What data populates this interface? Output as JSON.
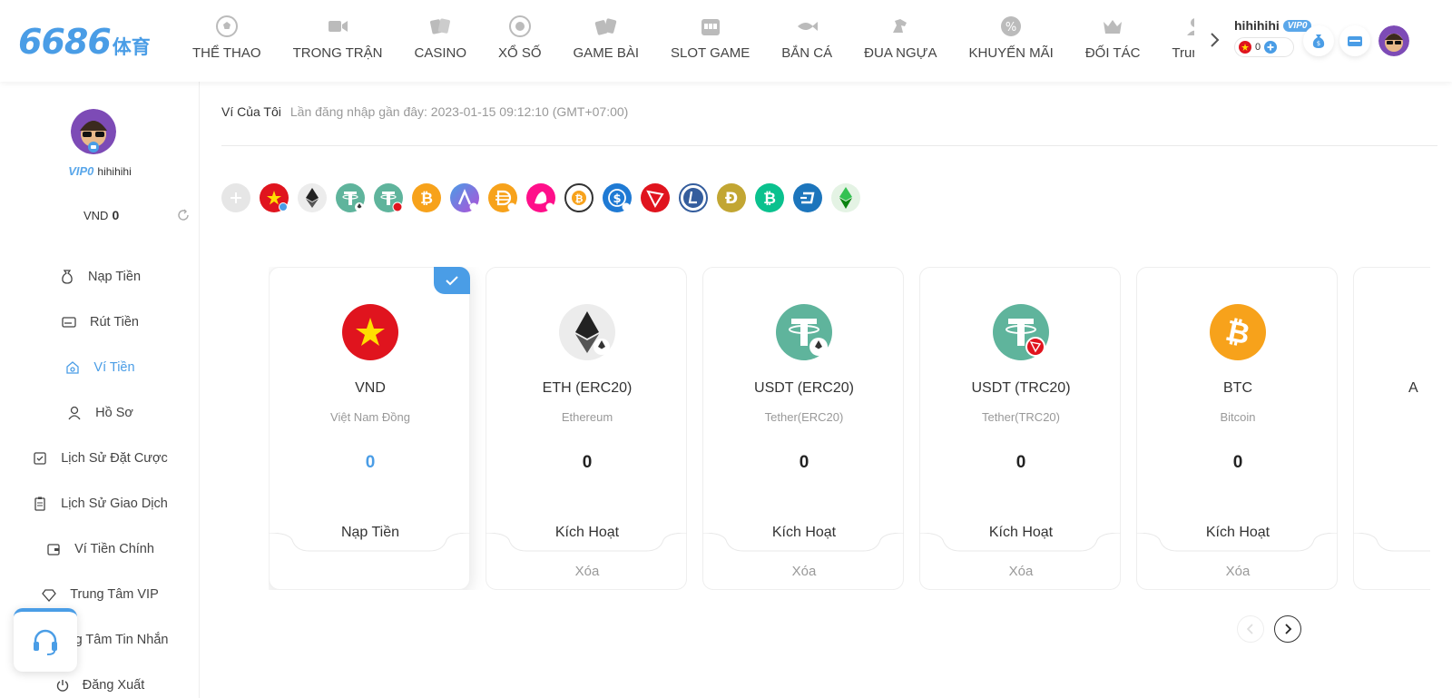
{
  "header": {
    "logo_num": "6686",
    "logo_sub": "体育",
    "nav": [
      {
        "label": "THỂ THAO",
        "icon": "soccer-ball-icon"
      },
      {
        "label": "TRONG TRẬN",
        "icon": "video-camera-icon"
      },
      {
        "label": "CASINO",
        "icon": "playing-cards-icon"
      },
      {
        "label": "XỔ SỐ",
        "icon": "lottery-ball-icon"
      },
      {
        "label": "GAME BÀI",
        "icon": "card-game-icon"
      },
      {
        "label": "SLOT GAME",
        "icon": "slot-machine-icon"
      },
      {
        "label": "BẮN CÁ",
        "icon": "fish-icon"
      },
      {
        "label": "ĐUA NGỰA",
        "icon": "horse-icon"
      },
      {
        "label": "KHUYẾN MÃI",
        "icon": "percent-badge-icon"
      },
      {
        "label": "ĐỐI TÁC",
        "icon": "crown-icon"
      },
      {
        "label": "Trung T",
        "icon": "person-icon"
      }
    ],
    "user": {
      "name": "hihihihi",
      "vip": "VIP0",
      "balance": "0"
    }
  },
  "sidebar": {
    "vip": "VIP0",
    "username": "hihihihi",
    "currency": "VND",
    "balance": "0",
    "menu": [
      {
        "label": "Nạp Tiền",
        "icon": "money-bag-icon"
      },
      {
        "label": "Rút Tiền",
        "icon": "card-icon"
      },
      {
        "label": "Ví Tiền",
        "icon": "wallet-icon"
      },
      {
        "label": "Hồ Sơ",
        "icon": "user-icon"
      },
      {
        "label": "Lịch Sử Đặt Cược",
        "icon": "checklist-icon"
      },
      {
        "label": "Lịch Sử Giao Dịch",
        "icon": "clipboard-icon"
      },
      {
        "label": "Ví Tiền Chính",
        "icon": "purse-icon"
      },
      {
        "label": "Trung Tâm VIP",
        "icon": "diamond-icon"
      },
      {
        "label": "ng Tâm Tin Nhắn",
        "icon": "message-icon"
      },
      {
        "label": "Đăng Xuất",
        "icon": "power-icon"
      }
    ]
  },
  "main": {
    "title": "Ví Của Tôi",
    "last_login": "Lần đăng nhập gần đây: 2023-01-15 09:12:10 (GMT+07:00)",
    "cards": [
      {
        "name": "VND",
        "sub": "Việt Nam Đồng",
        "balance": "0",
        "action": "Nạp Tiền",
        "del": ""
      },
      {
        "name": "ETH (ERC20)",
        "sub": "Ethereum",
        "balance": "0",
        "action": "Kích Hoạt",
        "del": "Xóa"
      },
      {
        "name": "USDT (ERC20)",
        "sub": "Tether(ERC20)",
        "balance": "0",
        "action": "Kích Hoạt",
        "del": "Xóa"
      },
      {
        "name": "USDT (TRC20)",
        "sub": "Tether(TRC20)",
        "balance": "0",
        "action": "Kích Hoạt",
        "del": "Xóa"
      },
      {
        "name": "BTC",
        "sub": "Bitcoin",
        "balance": "0",
        "action": "Kích Hoạt",
        "del": "Xóa"
      }
    ],
    "partial_card_text": "A"
  },
  "colors": {
    "accent": "#4a9de6",
    "vn_red": "#e0141e",
    "usdt_green": "#5fb49c",
    "btc_orange": "#f7a21b"
  }
}
